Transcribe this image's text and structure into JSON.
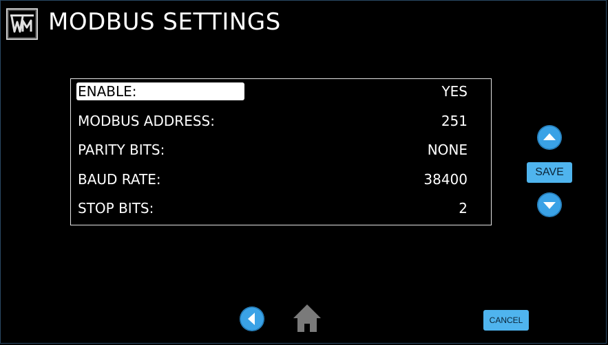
{
  "window": {
    "title": "MODBUS SETTINGS",
    "logo": "W-M"
  },
  "settings": {
    "rows": [
      {
        "label": "ENABLE:",
        "value": "YES",
        "selected": true
      },
      {
        "label": "MODBUS ADDRESS:",
        "value": "251",
        "selected": false
      },
      {
        "label": "PARITY BITS:",
        "value": "NONE",
        "selected": false
      },
      {
        "label": "BAUD RATE:",
        "value": "38400",
        "selected": false
      },
      {
        "label": "STOP BITS:",
        "value": "2",
        "selected": false
      }
    ]
  },
  "controls": {
    "save_label": "SAVE",
    "cancel_label": "CANCEL",
    "up_icon": "chevron-up-icon",
    "down_icon": "chevron-down-icon",
    "back_icon": "arrow-left-icon",
    "home_icon": "home-icon"
  },
  "colors": {
    "background": "#000000",
    "accent": "#3aa2e6",
    "button": "#4fb4ee",
    "home": "#7a7a7a"
  }
}
